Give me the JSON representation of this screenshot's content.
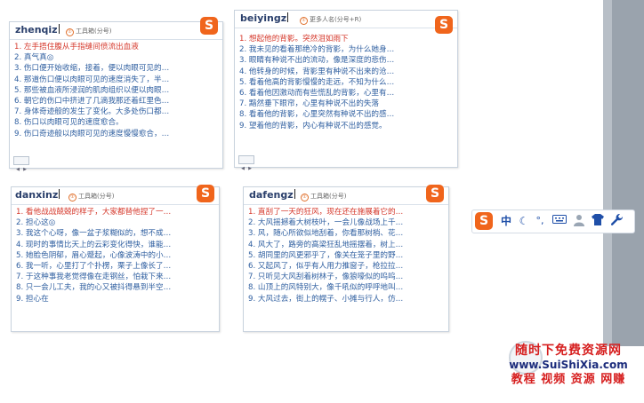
{
  "windows": [
    {
      "code": "zhenqiz",
      "hint": "工具箱(分号)",
      "logo": "S",
      "candidates": [
        "1. 左手捂住腹从手指缝间偾流出血液",
        "2. 真气真◎",
        "3. 伤口便开始收缩，接着，便以肉眼可见的…",
        "4. 那道伤口便以肉眼可见的速度消失了，半…",
        "5. 那些被血液所浸润的肌肉组织以便以肉眼…",
        "6. 朝它的伤口中挤进了几滴我那还着红里色…",
        "7. 身体奇迹般的发生了变化。大多处伤口都…",
        "8. 伤口以肉眼可见的速度愈合。",
        "9. 伤口奇迹般以肉眼可见的速度慢慢愈合，…"
      ]
    },
    {
      "code": "beiyingz",
      "hint": "更多人名(分号+R)",
      "logo": "S",
      "candidates": [
        "1. 想起他的背影。突然泪如雨下",
        "2. 我未见的看着那绝冷的背影，为什么她身…",
        "3. 眼睛有种说不出的流动，像是深度的悲伤…",
        "4. 他转身的时候，背影里有种说不出来的沧…",
        "5. 看着他高的背影慢慢的走远，不知为什么…",
        "6. 看着他因激动而有些慌乱的背影，心里有…",
        "7. 黯然垂下眼帘，心里有种说不出的失落",
        "8. 看着他的背影，心里突然有种说不出的感…",
        "9. 望着他的背影，内心有种说不出的感觉。"
      ]
    },
    {
      "code": "danxinz",
      "hint": "工具箱(分号)",
      "logo": "S",
      "candidates": [
        "1. 看他战战兢兢的样子，大家都替他捏了一…",
        "2. 担心这◎",
        "3. 我这个心呀，像一盆子浆糊似的，想不成…",
        "4. 现时的事情比天上的云彩变化得快，谁能…",
        "5. 她脸色阴郁，眉心蹙起，心像波涛中的小…",
        "6. 我一听，心里打了个扑楞，栗子上像长了…",
        "7. 于这种事我老觉得像在走钢丝，怕栽下来…",
        "8. 只一会儿工夫，我的心又被抖得悬到半空…",
        "9. 担心在"
      ]
    },
    {
      "code": "dafengz",
      "hint": "工具箱(分号)",
      "logo": "S",
      "candidates": [
        "1. 直刮了一天的狂风，现在还在施展着它的…",
        "2. 大风摇撼着大树枝叶，一会儿像战场上千…",
        "3. 风，随心所欲似地刮着，你看那树梢、花…",
        "4. 风大了，路旁的高梁狂乱地摇摆着，树上…",
        "5. 胡同里的风更邪乎了，像关在笼子里的野…",
        "6. 又起风了，似乎有人用力推窗子，枪拉拉…",
        "7. 只听见大风刮着树林子，像狼嚎似的呜呜…",
        "8. 山顶上的风特别大，像千吼似的呼呼地叫…",
        "9. 大风过去，街上的幌子、小摊与行人，仿…"
      ]
    }
  ],
  "toolbar": {
    "logo": "S",
    "mode_zh": "中",
    "icons": [
      "moon-icon",
      "punctuation-icon",
      "keyboard-icon",
      "user-icon",
      "shirt-icon",
      "wrench-icon"
    ]
  },
  "watermark": {
    "line1": "随时下免费资源网",
    "line2": "www.SuiShiXia.com",
    "line3": "教程 视频 资源 网赚"
  }
}
